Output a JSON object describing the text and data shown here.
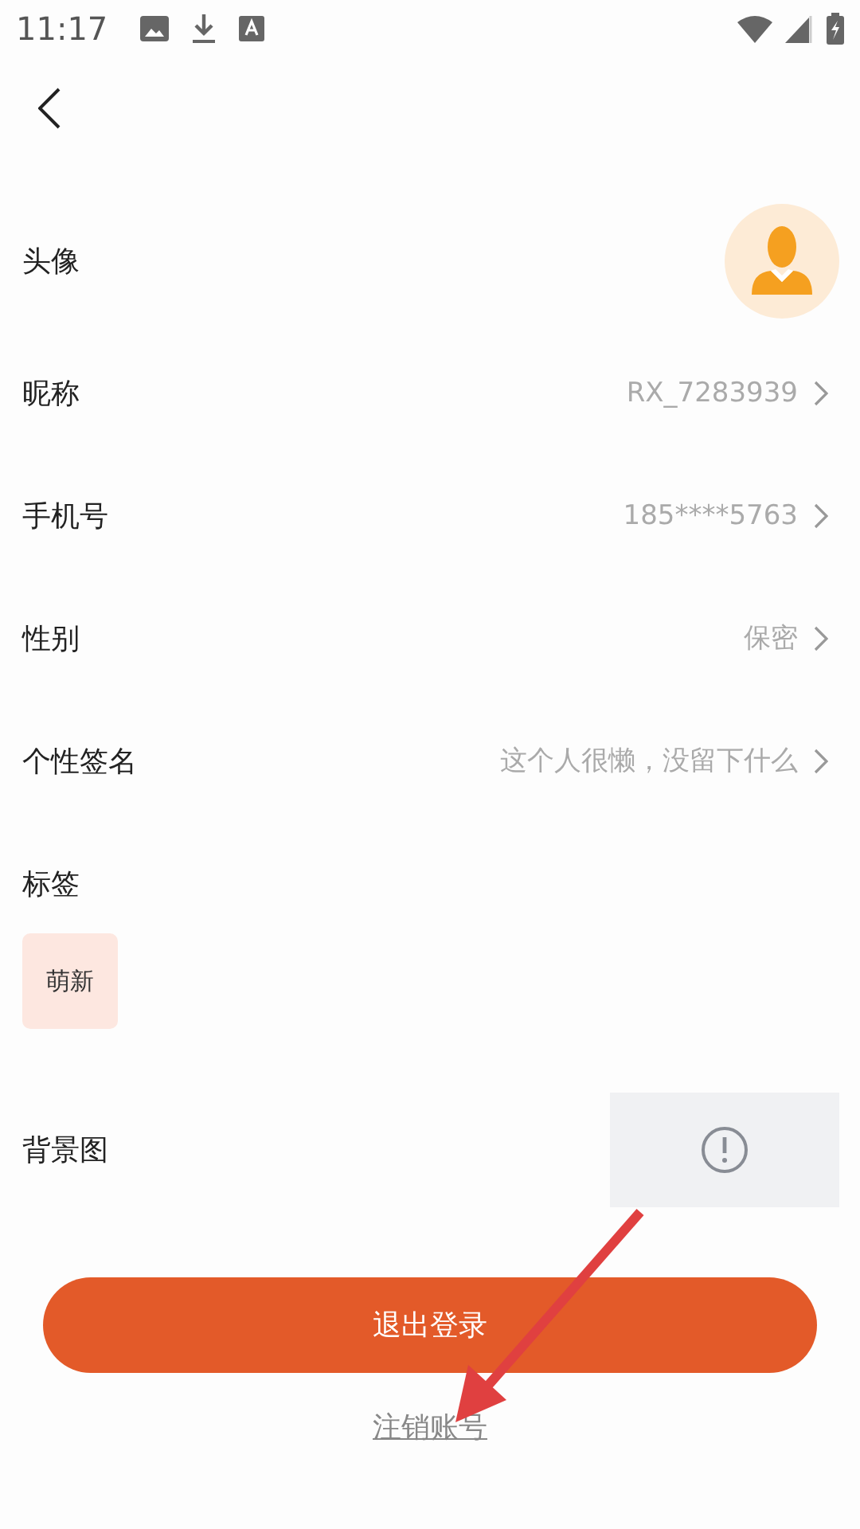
{
  "status_bar": {
    "time": "11:17"
  },
  "rows": [
    {
      "kind": "avatar",
      "label": "头像"
    },
    {
      "kind": "text",
      "label": "昵称",
      "value": "RX_7283939"
    },
    {
      "kind": "text",
      "label": "手机号",
      "value": "185****5763"
    },
    {
      "kind": "text",
      "label": "性别",
      "value": "保密"
    },
    {
      "kind": "text",
      "label": "个性签名",
      "value": "这个人很懒，没留下什么"
    },
    {
      "kind": "tags",
      "label": "标签",
      "tags": [
        "萌新"
      ]
    },
    {
      "kind": "image",
      "label": "背景图"
    }
  ],
  "logout_button": "退出登录",
  "delete_account_link": "注销账号"
}
